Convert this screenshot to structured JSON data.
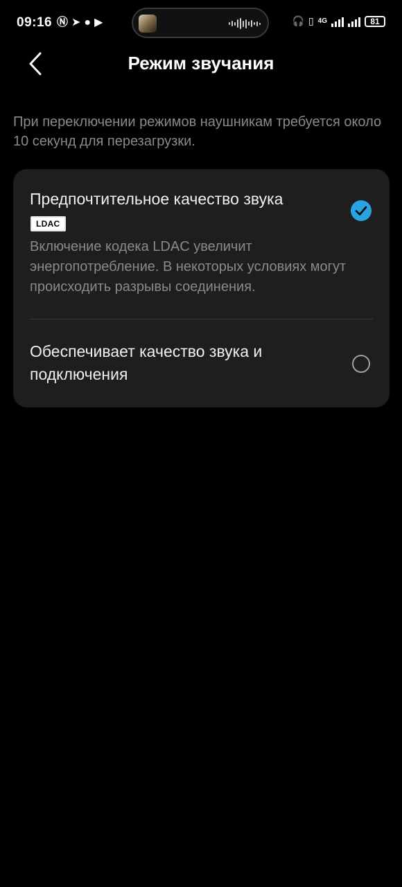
{
  "status_bar": {
    "time": "09:16",
    "battery": "81",
    "network": "4G"
  },
  "header": {
    "title": "Режим звучания"
  },
  "description": "При переключении режимов наушникам требуется около 10 секунд для перезагрузки.",
  "options": [
    {
      "title": "Предпочтительное качество звука",
      "badge": "LDAC",
      "description": "Включение кодека LDAC увеличит энергопотребление. В некоторых условиях могут происходить разрывы соединения.",
      "selected": true
    },
    {
      "title": "Обеспечивает качество звука и подключения",
      "selected": false
    }
  ],
  "colors": {
    "accent": "#29a3e2",
    "card_bg": "#1e1e20",
    "secondary_text": "#8a8a8a"
  }
}
